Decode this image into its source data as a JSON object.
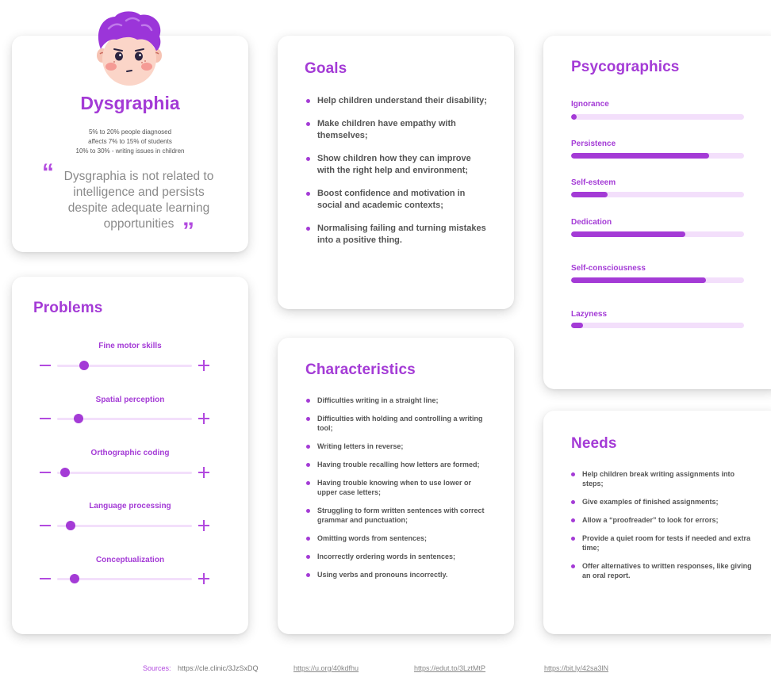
{
  "profile": {
    "title": "Dysgraphia",
    "stats": [
      "5% to 20% people diagnosed",
      "affects 7% to 15% of students",
      "10% to 30% - writing issues in children"
    ],
    "quote_open": "“",
    "quote": "Dysgraphia is not related to intelligence and persists despite adequate learning opportunities",
    "quote_close": "”"
  },
  "goals": {
    "heading": "Goals",
    "items": [
      "Help children understand their disability;",
      "Make children have empathy with themselves;",
      "Show children how they can improve with the right help and environment;",
      "Boost confidence and motivation in social and academic contexts;",
      "Normalising failing and turning mistakes into a positive thing."
    ]
  },
  "psycographics": {
    "heading": "Psycographics",
    "items": [
      {
        "label": "Ignorance",
        "value": 0.03
      },
      {
        "label": "Persistence",
        "value": 0.8
      },
      {
        "label": "Self-esteem",
        "value": 0.21
      },
      {
        "label": "Dedication",
        "value": 0.66
      },
      {
        "label": "Self-consciousness",
        "value": 0.78
      },
      {
        "label": "Lazyness",
        "value": 0.07
      }
    ]
  },
  "problems": {
    "heading": "Problems",
    "items": [
      {
        "label": "Fine motor skills",
        "value": 0.2
      },
      {
        "label": "Spatial perception",
        "value": 0.16
      },
      {
        "label": "Orthographic coding",
        "value": 0.06
      },
      {
        "label": "Language processing",
        "value": 0.1
      },
      {
        "label": "Conceptualization",
        "value": 0.13
      }
    ]
  },
  "characteristics": {
    "heading": "Characteristics",
    "items": [
      "Difficulties writing in a straight line;",
      "Difficulties with holding and controlling a writing tool;",
      "Writing letters in reverse;",
      "Having trouble recalling how letters are formed;",
      "Having trouble knowing when to use lower or upper case letters;",
      "Struggling to form written sentences with correct grammar and punctuation;",
      "Omitting words from sentences;",
      "Incorrectly ordering words in sentences;",
      "Using verbs and pronouns incorrectly."
    ]
  },
  "needs": {
    "heading": "Needs",
    "items": [
      "Help children break writing assignments into steps;",
      "Give examples of finished assignments;",
      "Allow a “proofreader” to look for errors;",
      "Provide a quiet room for tests if needed and extra time;",
      "Offer alternatives to written responses, like giving an oral report."
    ]
  },
  "sources": {
    "label": "Sources:",
    "links": [
      "https://cle.clinic/3JzSxDQ",
      "https://u.org/40kdfhu",
      "https://edut.to/3LztMtP",
      "https://bit.ly/42sa3lN"
    ]
  },
  "colors": {
    "accent": "#a43bd6",
    "track": "#f3dffb",
    "hair": "#9b35d9",
    "skin": "#fbd5c8"
  }
}
